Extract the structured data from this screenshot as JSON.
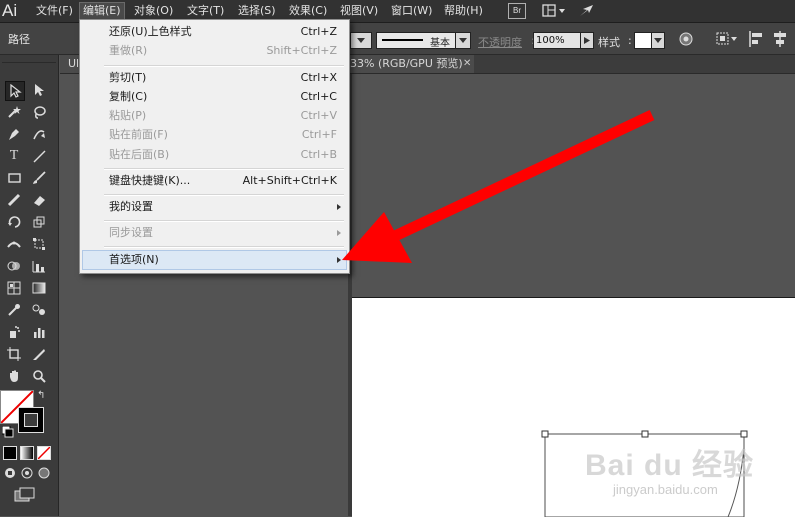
{
  "app": {
    "logo": "Ai"
  },
  "menubar": {
    "items": [
      "文件(F)",
      "编辑(E)",
      "对象(O)",
      "文字(T)",
      "选择(S)",
      "效果(C)",
      "视图(V)",
      "窗口(W)",
      "帮助(H)"
    ],
    "bridge_label": "Br"
  },
  "controlbar": {
    "label": "路径",
    "stroke_style": "基本",
    "opacity_label": "不透明度",
    "opacity_value": "100%",
    "style_label": "样式"
  },
  "tabs": {
    "left_fragment": "Ul",
    "document": "33% (RGB/GPU 预览)"
  },
  "edit_menu": {
    "items": [
      {
        "label": "还原(U)上色样式",
        "shortcut": "Ctrl+Z",
        "enabled": true
      },
      {
        "label": "重做(R)",
        "shortcut": "Shift+Ctrl+Z",
        "enabled": false
      },
      {
        "label": "剪切(T)",
        "shortcut": "Ctrl+X",
        "enabled": true
      },
      {
        "label": "复制(C)",
        "shortcut": "Ctrl+C",
        "enabled": true
      },
      {
        "label": "粘贴(P)",
        "shortcut": "Ctrl+V",
        "enabled": false
      },
      {
        "label": "贴在前面(F)",
        "shortcut": "Ctrl+F",
        "enabled": false
      },
      {
        "label": "贴在后面(B)",
        "shortcut": "Ctrl+B",
        "enabled": false
      },
      {
        "label": "键盘快捷键(K)...",
        "shortcut": "Alt+Shift+Ctrl+K",
        "enabled": true
      },
      {
        "label": "我的设置",
        "shortcut": "",
        "enabled": true,
        "submenu": true
      },
      {
        "label": "同步设置",
        "shortcut": "",
        "enabled": false,
        "submenu": true
      },
      {
        "label": "首选项(N)",
        "shortcut": "",
        "enabled": true,
        "submenu": true,
        "highlighted": true
      }
    ]
  },
  "annotation": {
    "color": "#ff0000"
  },
  "watermark": {
    "brand": "Bai du 经验",
    "url": "jingyan.baidu.com"
  }
}
